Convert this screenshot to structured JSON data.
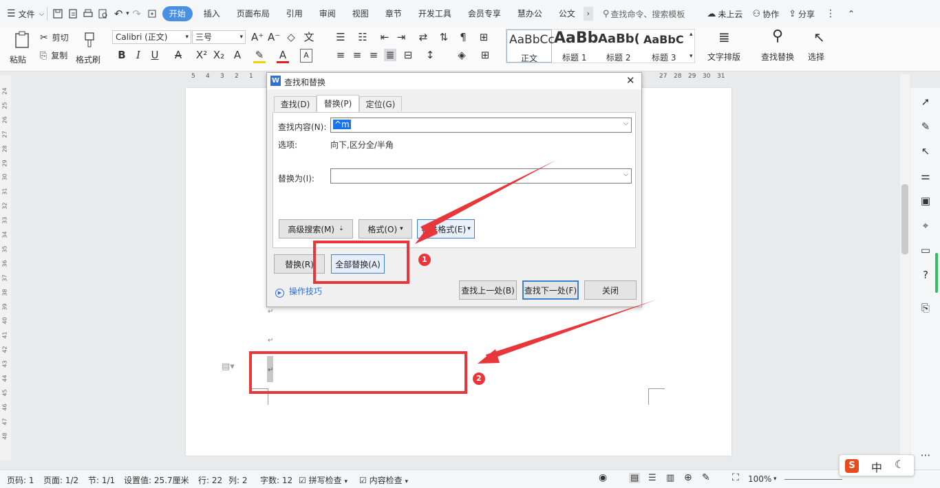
{
  "menubar": {
    "file_label": "文件",
    "tabs": [
      "开始",
      "插入",
      "页面布局",
      "引用",
      "审阅",
      "视图",
      "章节",
      "开发工具",
      "会员专享",
      "慧办公",
      "公文"
    ],
    "active_tab": "开始",
    "search_placeholder": "查找命令、搜索模板",
    "cloud_label": "未上云",
    "collab_label": "协作",
    "share_label": "分享"
  },
  "ribbon": {
    "paste_label": "粘贴",
    "cut_label": "剪切",
    "copy_label": "复制",
    "format_painter_label": "格式刷",
    "font_name": "Calibri (正文)",
    "font_size": "三号",
    "styles": [
      {
        "preview": "AaBbCc",
        "label": "正文"
      },
      {
        "preview": "AaBb",
        "label": "标题 1"
      },
      {
        "preview": "AaBb(",
        "label": "标题 2"
      },
      {
        "preview": "AaBbC",
        "label": "标题 3"
      }
    ],
    "text_layout_label": "文字排版",
    "find_replace_label": "查找替换",
    "select_label": "选择"
  },
  "ruler": {
    "top_left": [
      "5",
      "4",
      "3",
      "2",
      "1"
    ],
    "top_right": [
      "27",
      "28",
      "29",
      "30",
      "31"
    ],
    "left": [
      "24",
      "25",
      "26",
      "27",
      "28",
      "29",
      "30",
      "31",
      "32",
      "33",
      "34",
      "35",
      "36",
      "37",
      "38",
      "39",
      "40",
      "41",
      "42",
      "43",
      "44",
      "45",
      "46",
      "47",
      "48"
    ]
  },
  "dialog": {
    "title": "查找和替换",
    "tabs": [
      "查找(D)",
      "替换(P)",
      "定位(G)"
    ],
    "active_tab": "替换(P)",
    "find_label": "查找内容(N):",
    "find_value": "^m",
    "options_label": "选项:",
    "options_value": "向下,区分全/半角",
    "replace_label": "替换为(I):",
    "replace_value": "",
    "advanced_search_label": "高级搜索(M)",
    "format_label": "格式(O)",
    "special_format_label": "特殊格式(E)",
    "replace_button": "替换(R)",
    "replace_all_button": "全部替换(A)",
    "tips_label": "操作技巧",
    "find_prev_button": "查找上一处(B)",
    "find_next_button": "查找下一处(F)",
    "close_button": "关闭"
  },
  "annotations": {
    "badge1": "1",
    "badge2": "2",
    "color": "#e8373b"
  },
  "status": {
    "page_num": "页码: 1",
    "pages": "页面: 1/2",
    "section": "节: 1/1",
    "setting": "设置值: 25.7厘米",
    "row": "行: 22",
    "col": "列: 2",
    "words": "字数: 12",
    "spell_check": "拼写检查",
    "content_check": "内容检查",
    "zoom": "100%"
  },
  "ime": {
    "lang": "中"
  },
  "colors": {
    "accent": "#4a90e2",
    "annotation_red": "#e8373b"
  }
}
